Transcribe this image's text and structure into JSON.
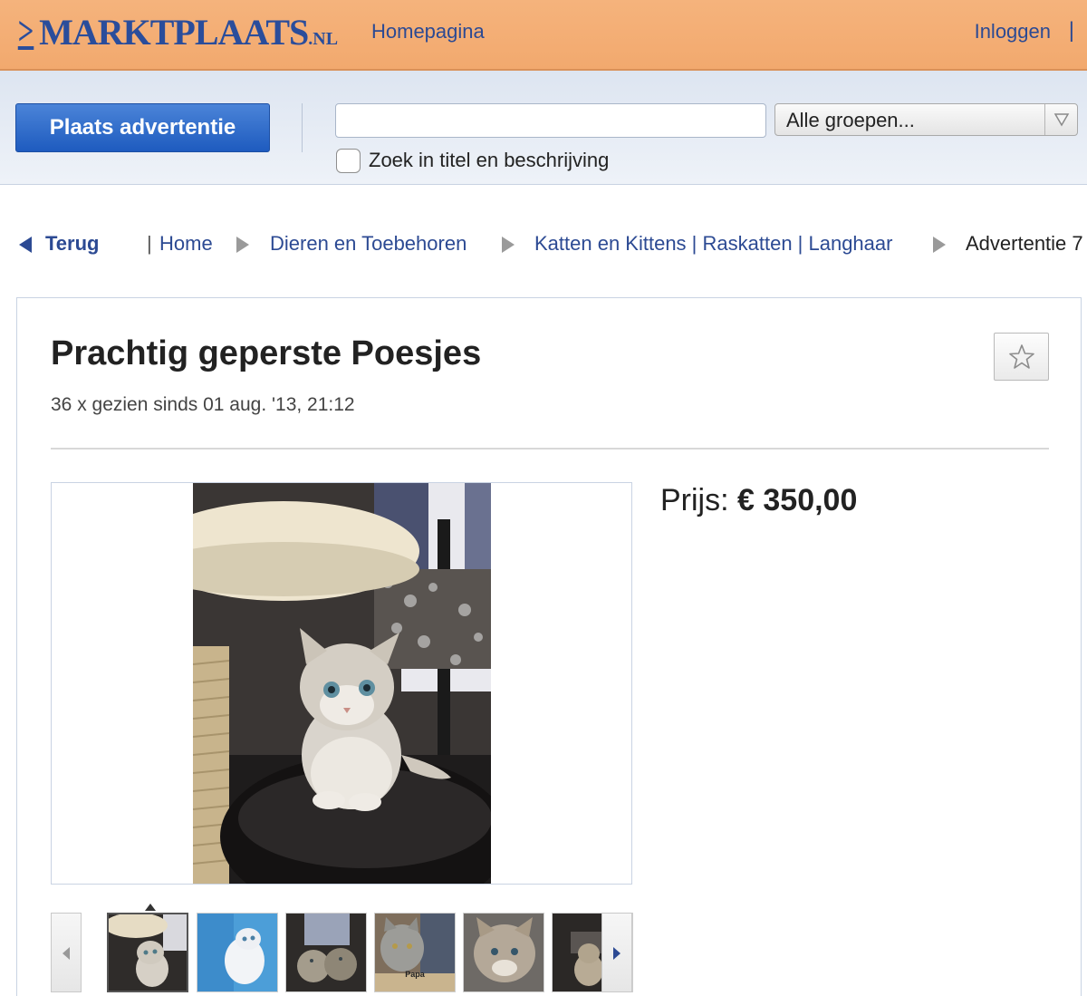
{
  "header": {
    "logo_main": "MARKTPLAATS",
    "logo_suffix": ".NL",
    "nav_home": "Homepagina",
    "nav_login": "Inloggen",
    "nav_separator": "|"
  },
  "search": {
    "place_ad_label": "Plaats advertentie",
    "query_value": "",
    "group_selected": "Alle groepen...",
    "title_desc_checkbox_label": "Zoek in titel en beschrijving",
    "title_desc_checked": false
  },
  "breadcrumb": {
    "back_label": "Terug",
    "separator": "|",
    "items": [
      "Home",
      "Dieren en Toebehoren",
      "Katten en Kittens | Raskatten | Langhaar"
    ],
    "current": "Advertentie 7"
  },
  "listing": {
    "title": "Prachtig geperste Poesjes",
    "views": "36 x gezien sinds 01 aug. '13, 21:12",
    "price_label": "Prijs:",
    "price_value": "€ 350,00",
    "favorite_icon": "star-icon",
    "thumbnail_count": 6,
    "active_thumbnail": 1,
    "thumbnail_captions": [
      "",
      "",
      "",
      "Papa",
      "",
      ""
    ]
  },
  "colors": {
    "header_orange": "#f2a96e",
    "link_blue": "#2c4a93",
    "button_blue": "#1e5bbf",
    "search_bg": "#e6ecf5"
  }
}
